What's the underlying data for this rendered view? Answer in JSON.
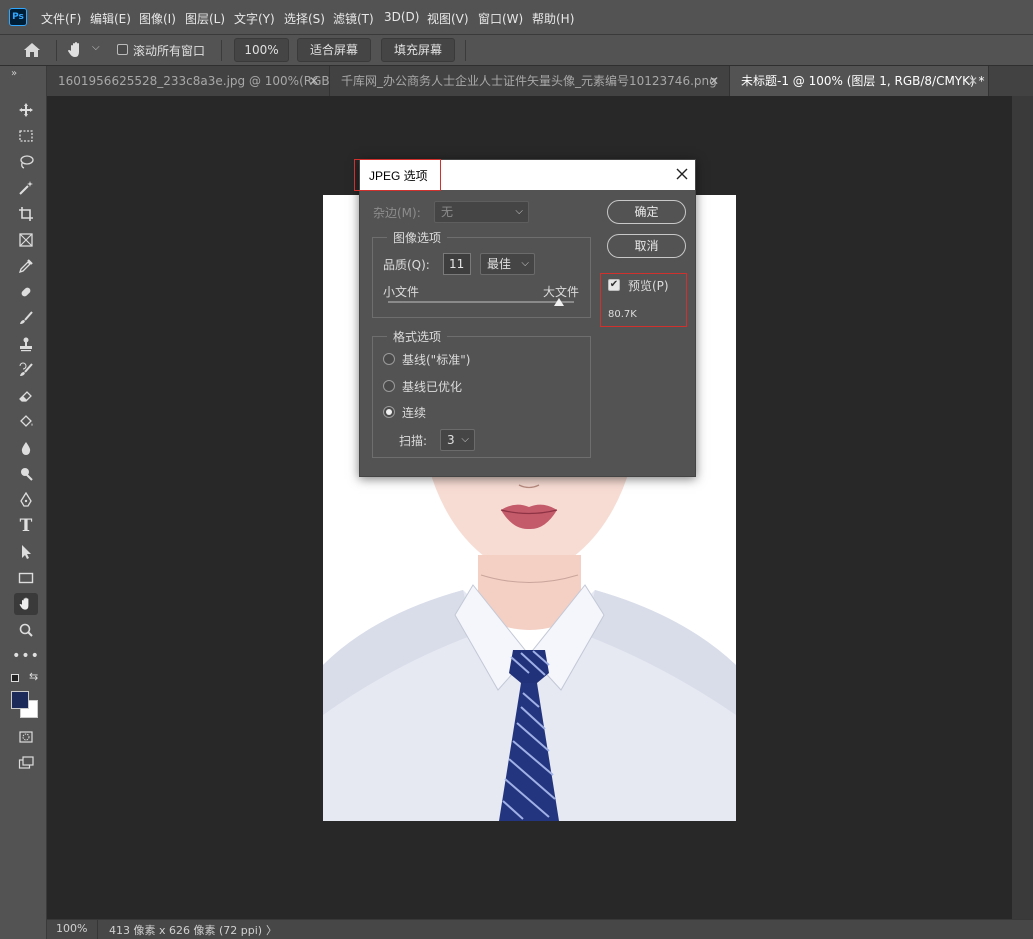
{
  "menubar": {
    "app_icon_label": "Ps",
    "items": [
      "文件(F)",
      "编辑(E)",
      "图像(I)",
      "图层(L)",
      "文字(Y)",
      "选择(S)",
      "滤镜(T)",
      "3D(D)",
      "视图(V)",
      "窗口(W)",
      "帮助(H)"
    ]
  },
  "options_bar": {
    "scroll_all_label": "滚动所有窗口",
    "zoom_value": "100%",
    "fit_screen": "适合屏幕",
    "fill_screen": "填充屏幕"
  },
  "tabs": [
    {
      "label": "1601956625528_233c8a3e.jpg @ 100%(RGB/...",
      "active": false
    },
    {
      "label": "千库网_办公商务人士企业人士证件矢量头像_元素编号10123746.png",
      "active": false
    },
    {
      "label": "未标题-1 @ 100% (图层 1, RGB/8/CMYK) *",
      "active": true
    }
  ],
  "dialog": {
    "title": "JPEG 选项",
    "matte_label": "杂边(M):",
    "matte_value": "无",
    "image_options_title": "图像选项",
    "quality_label": "品质(Q):",
    "quality_value": "11",
    "quality_preset": "最佳",
    "small_file": "小文件",
    "large_file": "大文件",
    "quality_fraction": 0.92,
    "format_options_title": "格式选项",
    "format_baseline": "基线(\"标准\")",
    "format_optimized": "基线已优化",
    "format_progressive": "连续",
    "selected_format": "progressive",
    "scans_label": "扫描:",
    "scans_value": "3",
    "ok": "确定",
    "cancel": "取消",
    "preview_label": "预览(P)",
    "preview_checked": true,
    "file_size": "80.7K"
  },
  "status": {
    "zoom": "100%",
    "doc_info": "413 像素 x 626 像素 (72 ppi)",
    "arrow": "〉"
  },
  "colors": {
    "foreground": "#1c2a5a",
    "background": "#ffffff",
    "highlight_box": "#d0312d"
  }
}
